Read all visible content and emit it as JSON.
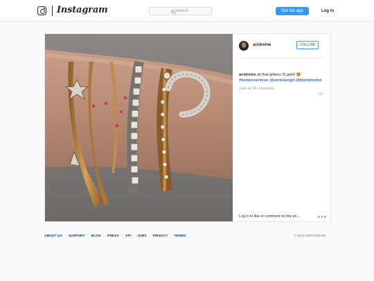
{
  "header": {
    "logo_text": "Instagram",
    "search_placeholder": "Search",
    "get_app_label": "Get the app",
    "login_label": "Log in"
  },
  "post": {
    "username": "acidreine",
    "follow_label": "FOLLOW",
    "caption_user": "acidreine",
    "caption_text": " all that glitters IS gold! 😍 ",
    "caption_tags": "#bestpreseritever @anninavogel @libertylondon",
    "view_all_label": "view all 34 comments",
    "time_ago": "1h",
    "login_link": "Log in",
    "login_suffix": " to like or comment on this po..."
  },
  "footer": {
    "links": [
      "ABOUT US",
      "SUPPORT",
      "BLOG",
      "PRESS",
      "API",
      "JOBS",
      "PRIVACY",
      "TERMS"
    ],
    "copyright": "© 2016 INSTAGRAM"
  },
  "colors": {
    "accent": "#3897f0",
    "link": "#003569",
    "muted": "#999999"
  },
  "icons": {
    "logo": "camera-glyph-icon",
    "search": "search-icon",
    "more": "more-options-icon"
  }
}
